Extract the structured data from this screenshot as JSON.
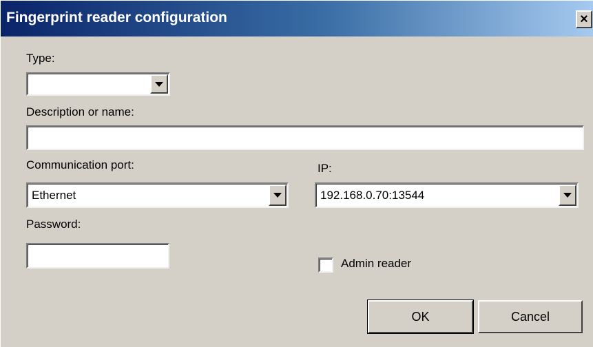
{
  "window": {
    "title": "Fingerprint reader configuration",
    "close_label": "×"
  },
  "form": {
    "type_label": "Type:",
    "type_value": "",
    "description_label": "Description or name:",
    "description_value": "",
    "port_label": "Communication port:",
    "port_value": "Ethernet",
    "ip_label": "IP:",
    "ip_value": "192.168.0.70:13544",
    "password_label": "Password:",
    "password_value": "",
    "admin_label": "Admin reader",
    "admin_checked": false
  },
  "buttons": {
    "ok_label": "OK",
    "cancel_label": "Cancel"
  },
  "colors": {
    "face": "#d4d0c8",
    "title_start": "#0a246a",
    "title_end": "#a6caf0"
  },
  "icons": {
    "close": "close-icon",
    "dropdown": "chevron-down-icon"
  }
}
